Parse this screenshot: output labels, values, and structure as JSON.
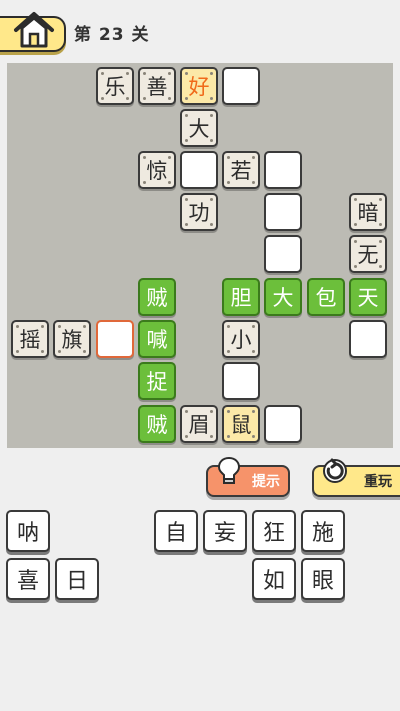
{
  "header": {
    "home_icon": "house-icon",
    "level_title": "第 23 关"
  },
  "board": {
    "cells": [
      {
        "id": "r0c2",
        "text": "乐",
        "style": "given"
      },
      {
        "id": "r0c3",
        "text": "善",
        "style": "given"
      },
      {
        "id": "r0c4",
        "text": "好",
        "style": "orange-text"
      },
      {
        "id": "r0c5",
        "text": "",
        "style": "blank"
      },
      {
        "id": "r1c4",
        "text": "大",
        "style": "given"
      },
      {
        "id": "r2c3",
        "text": "惊",
        "style": "given"
      },
      {
        "id": "r2c4",
        "text": "",
        "style": "blank"
      },
      {
        "id": "r2c5",
        "text": "若",
        "style": "given"
      },
      {
        "id": "r2c6",
        "text": "",
        "style": "blank"
      },
      {
        "id": "r3c4",
        "text": "功",
        "style": "given"
      },
      {
        "id": "r3c6",
        "text": "",
        "style": "blank"
      },
      {
        "id": "r3c8",
        "text": "暗",
        "style": "given"
      },
      {
        "id": "r4c6",
        "text": "",
        "style": "blank"
      },
      {
        "id": "r4c8",
        "text": "无",
        "style": "given"
      },
      {
        "id": "r5c3",
        "text": "贼",
        "style": "green"
      },
      {
        "id": "r5c5",
        "text": "胆",
        "style": "green"
      },
      {
        "id": "r5c6",
        "text": "大",
        "style": "green"
      },
      {
        "id": "r5c7",
        "text": "包",
        "style": "green"
      },
      {
        "id": "r5c8",
        "text": "天",
        "style": "green"
      },
      {
        "id": "r6c0",
        "text": "摇",
        "style": "given"
      },
      {
        "id": "r6c1",
        "text": "旗",
        "style": "given"
      },
      {
        "id": "r6c2",
        "text": "",
        "style": "active"
      },
      {
        "id": "r6c3",
        "text": "喊",
        "style": "green"
      },
      {
        "id": "r6c5",
        "text": "小",
        "style": "given"
      },
      {
        "id": "r6c8",
        "text": "",
        "style": "blank"
      },
      {
        "id": "r7c3",
        "text": "捉",
        "style": "green"
      },
      {
        "id": "r7c5",
        "text": "",
        "style": "blank"
      },
      {
        "id": "r8c3",
        "text": "贼",
        "style": "green"
      },
      {
        "id": "r8c4",
        "text": "眉",
        "style": "given"
      },
      {
        "id": "r8c5",
        "text": "鼠",
        "style": "yellow"
      },
      {
        "id": "r8c6",
        "text": "",
        "style": "blank"
      }
    ]
  },
  "actions": {
    "hint": {
      "label": "提示",
      "icon": "lightbulb-icon",
      "color": "#f6936a"
    },
    "replay": {
      "label": "重玩",
      "icon": "restart-icon",
      "color": "#ffe88a"
    }
  },
  "answer_tiles": [
    {
      "id": "t1",
      "text": "呐"
    },
    {
      "id": "t2",
      "text": "自"
    },
    {
      "id": "t3",
      "text": "妄"
    },
    {
      "id": "t4",
      "text": "狂"
    },
    {
      "id": "t5",
      "text": "施"
    },
    {
      "id": "t6",
      "text": "喜"
    },
    {
      "id": "t7",
      "text": "日"
    },
    {
      "id": "t8",
      "text": "如"
    },
    {
      "id": "t9",
      "text": "眼"
    }
  ],
  "colors": {
    "green_cell": "#6cbf3b",
    "highlight_text": "#f06a1a",
    "board_bg": "#bcbbb4"
  }
}
